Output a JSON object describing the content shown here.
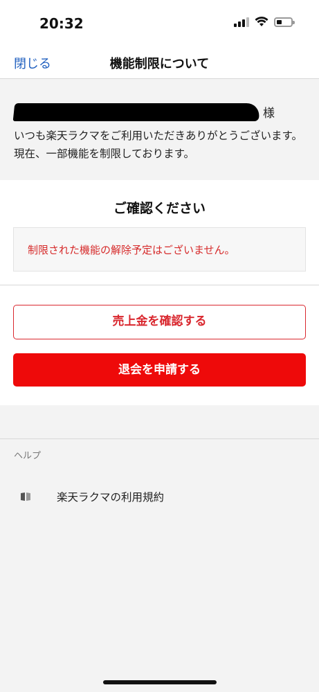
{
  "status_bar": {
    "time": "20:32"
  },
  "nav": {
    "close_label": "閉じる",
    "title": "機能制限について"
  },
  "greeting": {
    "honorific": "様",
    "message": "いつも楽天ラクマをご利用いただきありがとうございます。現在、一部機能を制限しております。"
  },
  "confirm": {
    "title": "ご確認ください",
    "notice": "制限された機能の解除予定はございません。"
  },
  "actions": {
    "check_sales_label": "売上金を確認する",
    "withdraw_label": "退会を申請する"
  },
  "help": {
    "header": "ヘルプ",
    "items": [
      {
        "label": "楽天ラクマの利用規約",
        "icon": "book-icon"
      }
    ]
  },
  "colors": {
    "accent_red": "#ee0a0a",
    "link_blue": "#1f5fbf",
    "notice_red": "#d62a2a"
  }
}
